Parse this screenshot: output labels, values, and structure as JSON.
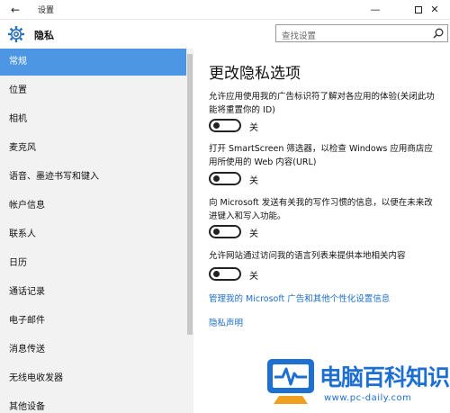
{
  "window": {
    "title": "设置",
    "back_glyph": "←",
    "minimize_glyph": "—",
    "close_glyph": "✕"
  },
  "header": {
    "title": "隐私",
    "icon": "gear-icon"
  },
  "search": {
    "placeholder": "查找设置",
    "icon": "search-icon"
  },
  "sidebar": {
    "items": [
      {
        "label": "常规",
        "active": true
      },
      {
        "label": "位置"
      },
      {
        "label": "相机"
      },
      {
        "label": "麦克风"
      },
      {
        "label": "语音、墨迹书写和键入"
      },
      {
        "label": "帐户信息"
      },
      {
        "label": "联系人"
      },
      {
        "label": "日历"
      },
      {
        "label": "通话记录"
      },
      {
        "label": "电子邮件"
      },
      {
        "label": "消息传送"
      },
      {
        "label": "无线电收发器"
      },
      {
        "label": "其他设备"
      }
    ]
  },
  "main": {
    "title": "更改隐私选项",
    "settings": [
      {
        "description": "允许应用使用我的广告标识符了解对各应用的体验(关闭此功能将重置你的 ID)",
        "state": "关"
      },
      {
        "description": "打开 SmartScreen 筛选器，以检查 Windows 应用商店应用所使用的 Web 内容(URL)",
        "state": "关"
      },
      {
        "description": "向 Microsoft 发送有关我的写作习惯的信息，以便在未来改进键入和写入功能。",
        "state": "关"
      },
      {
        "description": "允许网站通过访问我的语言列表来提供本地相关内容",
        "state": "关"
      }
    ],
    "links": {
      "manage_ads": "管理我的 Microsoft 广告和其他个性化设置信息",
      "privacy_statement": "隐私声明"
    }
  },
  "watermark": {
    "text": "电脑百科知识",
    "url": "www.pc-daily.com"
  },
  "colors": {
    "accent": "#4c96e3",
    "link": "#1e6fc6",
    "sidebar_bg": "#f2f2f2",
    "watermark": "#1d6fd1"
  }
}
